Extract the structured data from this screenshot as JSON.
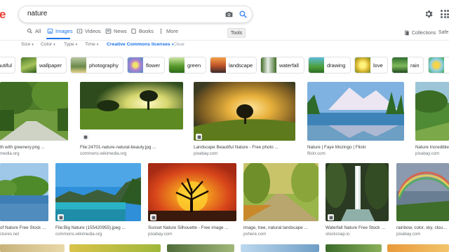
{
  "header": {
    "logo_fragment": "e",
    "search_query": "nature",
    "icons": {
      "camera": "camera-icon",
      "search": "search-icon",
      "settings": "gear-icon",
      "apps": "apps-grid-icon"
    }
  },
  "tabs": [
    {
      "label": "All",
      "icon": "search-icon",
      "active": false
    },
    {
      "label": "Images",
      "icon": "image-icon",
      "active": true
    },
    {
      "label": "Videos",
      "icon": "video-icon",
      "active": false
    },
    {
      "label": "News",
      "icon": "news-icon",
      "active": false
    },
    {
      "label": "Books",
      "icon": "book-icon",
      "active": false
    },
    {
      "label": "More",
      "icon": "more-dots-icon",
      "active": false
    }
  ],
  "tools_label": "Tools",
  "collections_label": "Collections",
  "safe_label": "Safe",
  "filters": [
    {
      "label": "Size",
      "caret": "▾"
    },
    {
      "label": "Color",
      "caret": "▾"
    },
    {
      "label": "Type",
      "caret": "▾"
    },
    {
      "label": "Time",
      "caret": "▾"
    },
    {
      "label": "Creative Commons licenses",
      "caret": "▾"
    },
    {
      "label": "Clear",
      "caret": ""
    }
  ],
  "chips": [
    "autiful",
    "wallpaper",
    "photography",
    "flower",
    "green",
    "landscape",
    "waterfall",
    "drawing",
    "love",
    "rain",
    ""
  ],
  "results": [
    {
      "caption": "th with greenery.png ...",
      "source": "media.org"
    },
    {
      "caption": "File:24701-nature-natural-beauty.jpg ...",
      "source": "commons.wikimedia.org"
    },
    {
      "caption": "Landscape Beautiful Nature - Free photo ...",
      "source": "pixabay.com"
    },
    {
      "caption": "Nature | Faye Mozingo | Flickr",
      "source": "flickr.com"
    },
    {
      "caption": "Nature Incredible",
      "source": "pixabay.com"
    },
    {
      "caption": "of Nature Free Stock Ph...",
      "source": "ctures.net"
    },
    {
      "caption": "File:Big Nature (155420955).jpeg ...",
      "source": "commons.wikimedia.org"
    },
    {
      "caption": "Sunset Nature Silhouette - Free image ...",
      "source": "pixabay.com"
    },
    {
      "caption": "image, tree, natural landscape ...",
      "source": "pxhere.com"
    },
    {
      "caption": "Waterfall Nature Free Stock CC...",
      "source": "stocksnap.io"
    },
    {
      "caption": "rainbow, color, sky, cloud, ...",
      "source": "pixabay.com"
    }
  ],
  "colors": {
    "accent": "#1a73e8",
    "logo_red": "#ea4335",
    "text_muted": "#70757a"
  }
}
